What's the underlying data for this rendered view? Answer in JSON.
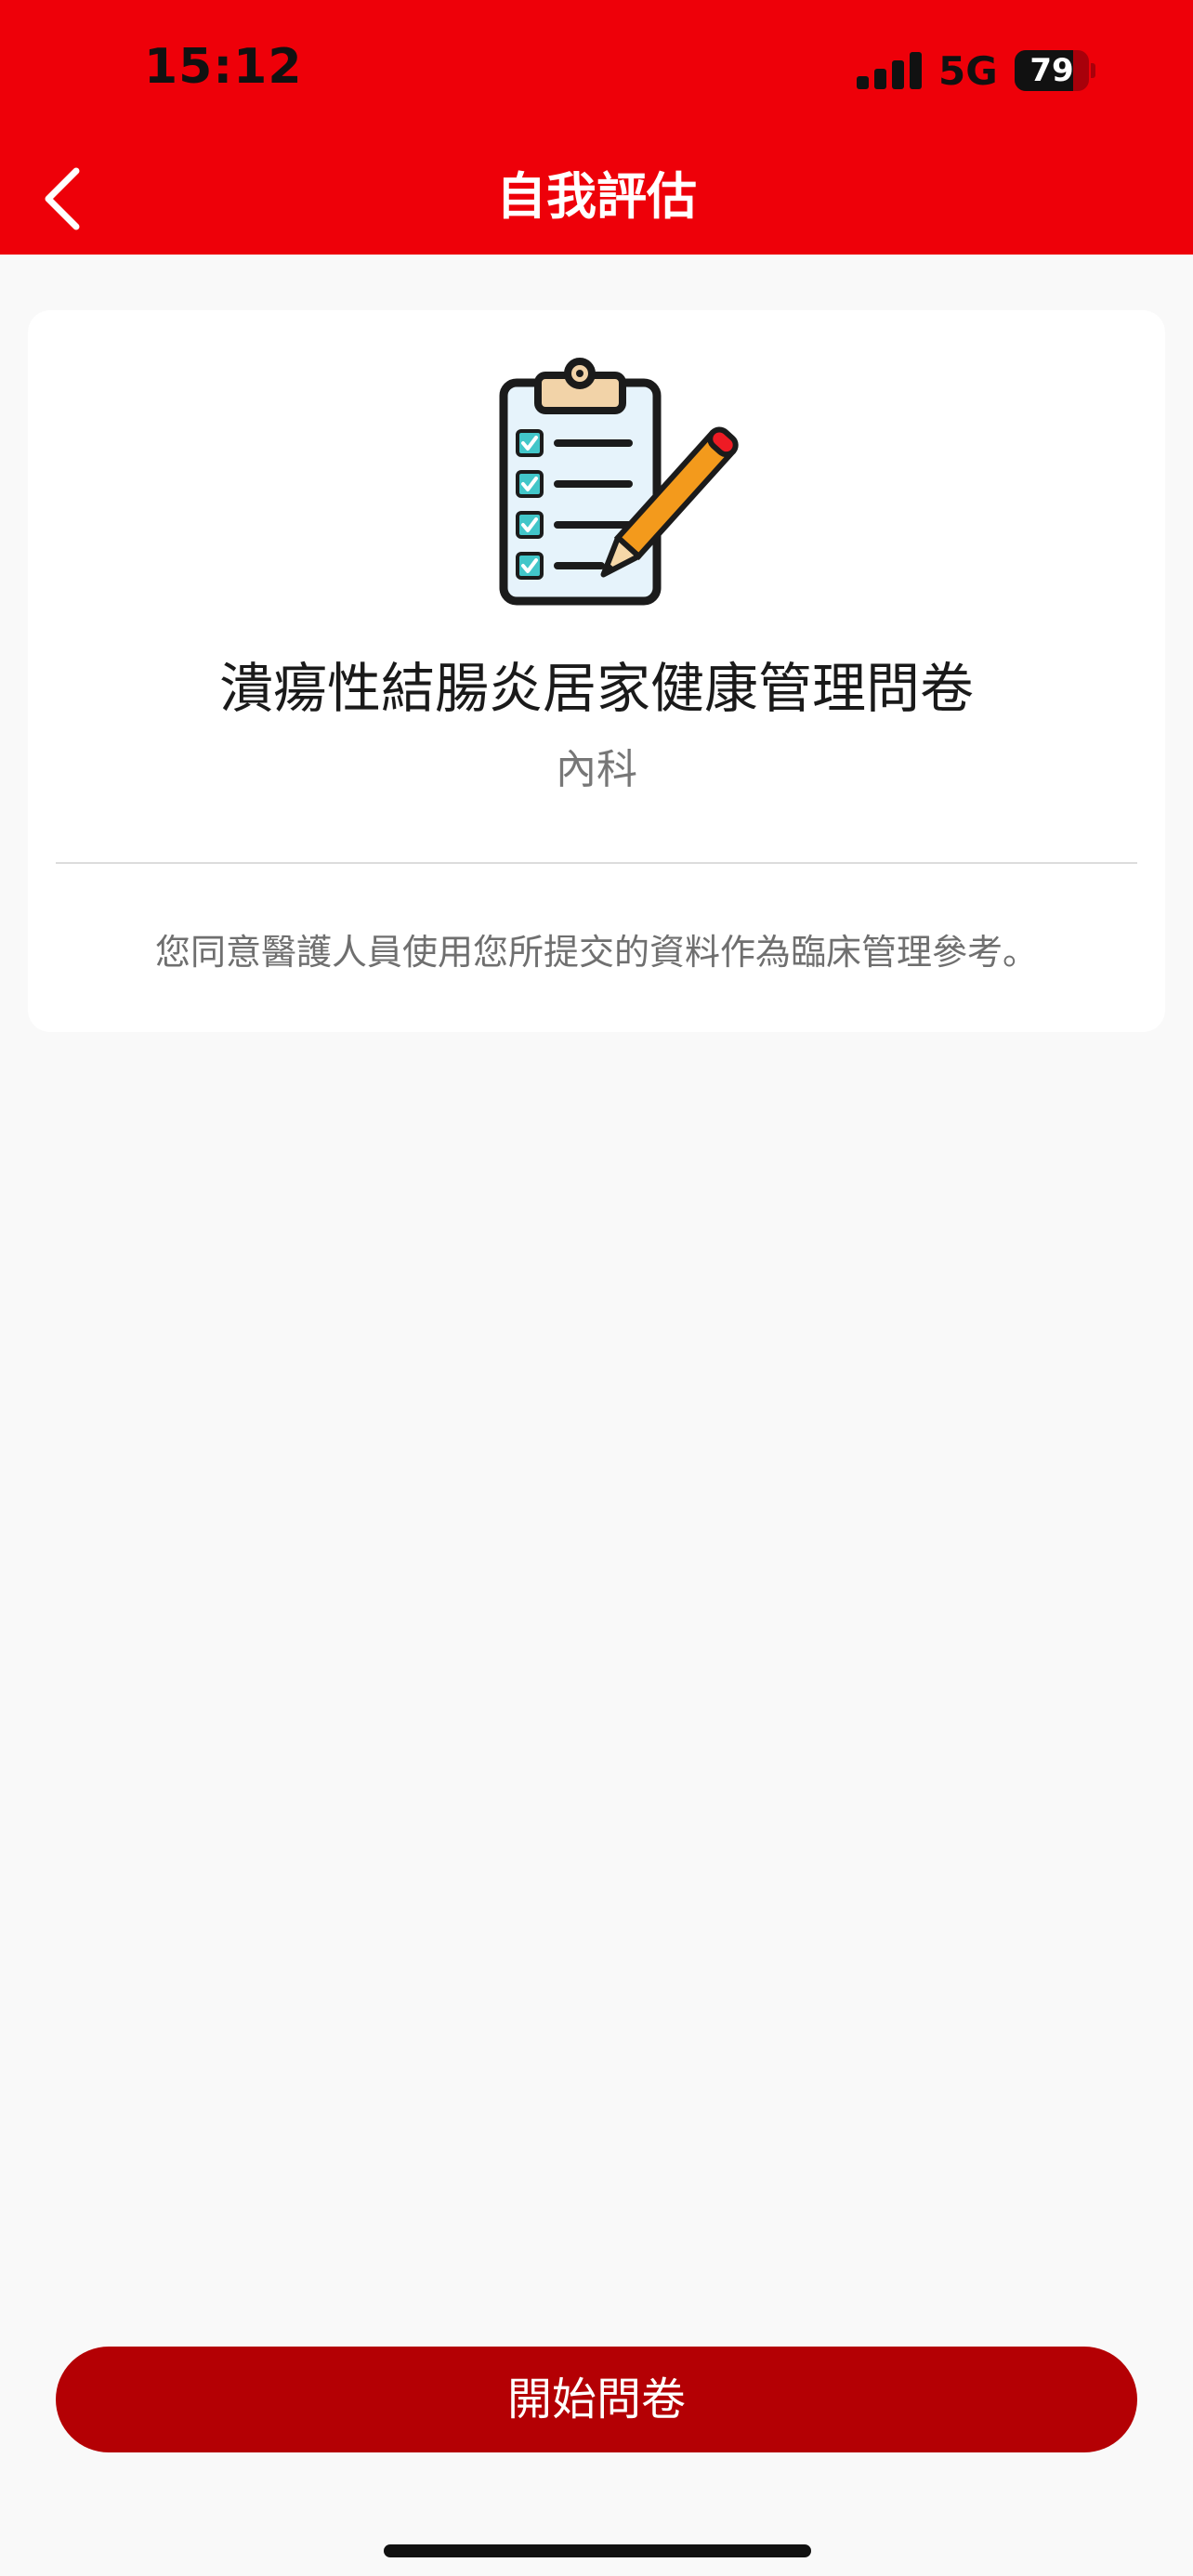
{
  "status_bar": {
    "time": "15:12",
    "network": "5G",
    "battery_percent": 79,
    "battery_label": "79"
  },
  "header": {
    "title": "自我評估",
    "back_icon": "chevron-left-icon"
  },
  "survey": {
    "icon": "clipboard-checklist-icon",
    "title": "潰瘍性結腸炎居家健康管理問卷",
    "department": "內科",
    "consent": "您同意醫護人員使用您所提交的資料作為臨床管理參考。"
  },
  "footer": {
    "start_button_label": "開始問卷"
  },
  "colors": {
    "header_bg": "#ee0009",
    "button_bg": "#b40004",
    "page_bg": "#f9f9f9"
  }
}
